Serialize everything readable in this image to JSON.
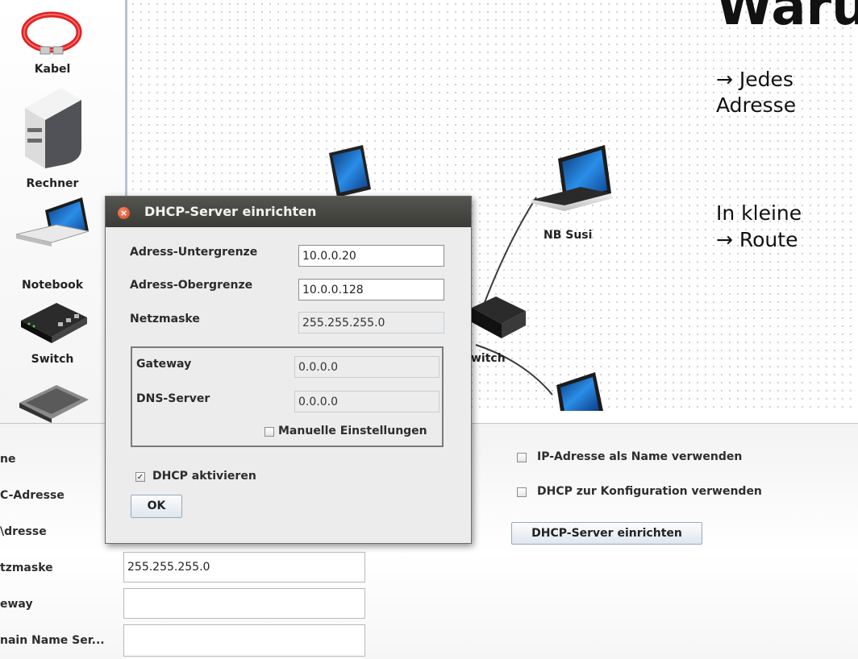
{
  "slide": {
    "title": "Waru",
    "line1": "→ Jedes",
    "line2": "Adresse",
    "line3": "In kleine",
    "line4": "→ Route"
  },
  "palette": {
    "items": [
      {
        "label": "Kabel",
        "icon": "cable-icon"
      },
      {
        "label": "Rechner",
        "icon": "computer-icon"
      },
      {
        "label": "Notebook",
        "icon": "notebook-icon"
      },
      {
        "label": "Switch",
        "icon": "switch-icon"
      },
      {
        "label": "",
        "icon": "router-icon"
      }
    ]
  },
  "canvas": {
    "nodes": [
      {
        "label": "NB Susi",
        "icon": "notebook-icon"
      },
      {
        "label": "witch",
        "icon": "switch-icon"
      }
    ]
  },
  "properties": {
    "labels": [
      "ne",
      "C-Adresse",
      "\\dresse",
      "tzmaske",
      "eway",
      "nain Name Ser..."
    ],
    "netmask_value": "255.255.255.0",
    "gateway_value": "",
    "dns_value": "",
    "use_ip_as_name_label": "IP-Adresse als Name verwenden",
    "use_dhcp_label": "DHCP zur Konfiguration verwenden",
    "dhcp_server_button": "DHCP-Server einrichten"
  },
  "dialog": {
    "title": "DHCP-Server einrichten",
    "lower_bound_label": "Adress-Untergrenze",
    "lower_bound_value": "10.0.0.20",
    "upper_bound_label": "Adress-Obergrenze",
    "upper_bound_value": "10.0.0.128",
    "netmask_label": "Netzmaske",
    "netmask_value": "255.255.255.0",
    "gateway_label": "Gateway",
    "gateway_value": "0.0.0.0",
    "dns_label": "DNS-Server",
    "dns_value": "0.0.0.0",
    "manual_settings_label": "Manuelle Einstellungen",
    "manual_settings_checked": false,
    "dhcp_active_label": "DHCP aktivieren",
    "dhcp_active_checked": true,
    "ok_label": "OK"
  },
  "colors": {
    "title_bar": "#3f3f3b",
    "close_button": "#e05a33",
    "canvas_dot": "#c9c9c9",
    "screen_blue": "#1e6fc9"
  }
}
